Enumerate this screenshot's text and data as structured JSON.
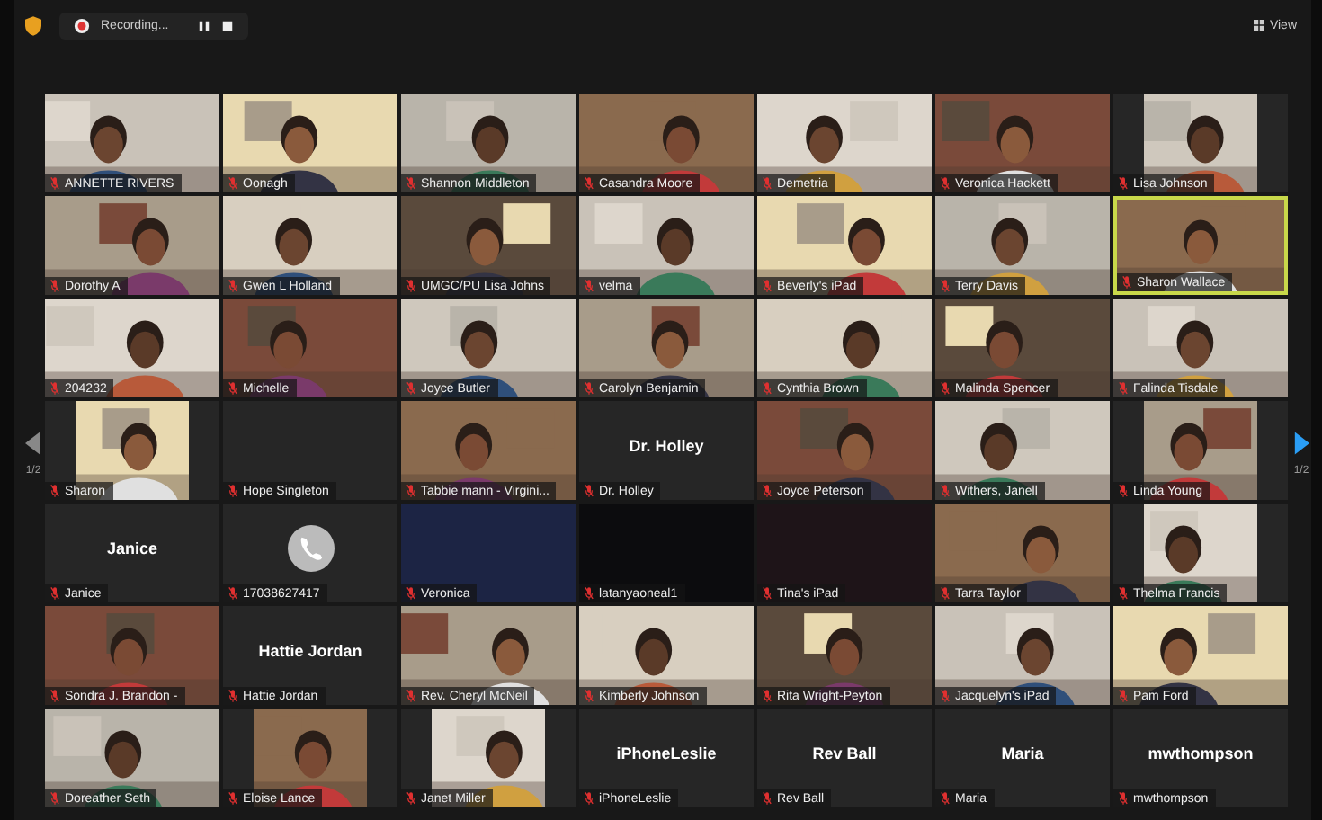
{
  "toolbar": {
    "recording": "Recording...",
    "view": "View"
  },
  "pager": {
    "left": "1/2",
    "right": "1/2"
  },
  "participants": [
    {
      "kind": "video",
      "name": "ANNETTE RIVERS",
      "muted": true,
      "active": false
    },
    {
      "kind": "video",
      "name": "Oonagh",
      "muted": true,
      "active": false
    },
    {
      "kind": "video",
      "name": "Shannon Middleton",
      "muted": true,
      "active": false
    },
    {
      "kind": "video",
      "name": "Casandra Moore",
      "muted": true,
      "active": false
    },
    {
      "kind": "video",
      "name": "Demetria",
      "muted": true,
      "active": false
    },
    {
      "kind": "video",
      "name": "Veronica Hackett",
      "muted": true,
      "active": false
    },
    {
      "kind": "portrait",
      "name": "Lisa Johnson",
      "muted": true,
      "active": false
    },
    {
      "kind": "video",
      "name": "Dorothy A",
      "muted": true,
      "active": false
    },
    {
      "kind": "video",
      "name": "Gwen L Holland",
      "muted": true,
      "active": false
    },
    {
      "kind": "video",
      "name": "UMGC/PU Lisa Johns",
      "muted": true,
      "active": false
    },
    {
      "kind": "video",
      "name": "velma",
      "muted": true,
      "active": false
    },
    {
      "kind": "video",
      "name": "Beverly's iPad",
      "muted": true,
      "active": false
    },
    {
      "kind": "video",
      "name": "Terry Davis",
      "muted": true,
      "active": false
    },
    {
      "kind": "video",
      "name": "Sharon Wallace",
      "muted": true,
      "active": true
    },
    {
      "kind": "video",
      "name": "204232",
      "muted": true,
      "active": false
    },
    {
      "kind": "video",
      "name": "Michelle",
      "muted": true,
      "active": false
    },
    {
      "kind": "video",
      "name": "Joyce Butler",
      "muted": true,
      "active": false
    },
    {
      "kind": "video",
      "name": "Carolyn Benjamin",
      "muted": true,
      "active": false
    },
    {
      "kind": "video",
      "name": "Cynthia Brown",
      "muted": true,
      "active": false
    },
    {
      "kind": "video",
      "name": "Malinda Spencer",
      "muted": true,
      "active": false
    },
    {
      "kind": "video",
      "name": "Falinda Tisdale",
      "muted": true,
      "active": false
    },
    {
      "kind": "portrait",
      "name": "Sharon",
      "muted": true,
      "active": false
    },
    {
      "kind": "blank",
      "name": "Hope Singleton",
      "muted": true,
      "active": false,
      "color": "#262626"
    },
    {
      "kind": "video",
      "name": "Tabbie mann - Virgini...",
      "muted": true,
      "active": false
    },
    {
      "kind": "name",
      "display_name": "Dr. Holley",
      "name": "Dr. Holley",
      "muted": true,
      "active": false
    },
    {
      "kind": "video",
      "name": "Joyce Peterson",
      "muted": true,
      "active": false
    },
    {
      "kind": "video",
      "name": "Withers, Janell",
      "muted": true,
      "active": false
    },
    {
      "kind": "portrait",
      "name": "Linda Young",
      "muted": true,
      "active": false
    },
    {
      "kind": "name",
      "display_name": "Janice",
      "name": "Janice",
      "muted": true,
      "active": false
    },
    {
      "kind": "phone",
      "name": "17038627417",
      "muted": true,
      "active": false
    },
    {
      "kind": "blank",
      "name": "Veronica",
      "muted": true,
      "active": false,
      "color": "#1c2444"
    },
    {
      "kind": "blank",
      "name": "latanyaoneal1",
      "muted": true,
      "active": false,
      "color": "#0c0c0e"
    },
    {
      "kind": "blank",
      "name": "Tina's iPad",
      "muted": true,
      "active": false,
      "color": "#1e1418"
    },
    {
      "kind": "video",
      "name": "Tarra Taylor",
      "muted": true,
      "active": false
    },
    {
      "kind": "portrait",
      "name": "Thelma Francis",
      "muted": true,
      "active": false
    },
    {
      "kind": "video",
      "name": "Sondra J. Brandon -",
      "muted": true,
      "active": false
    },
    {
      "kind": "name",
      "display_name": "Hattie Jordan",
      "name": "Hattie Jordan",
      "muted": true,
      "active": false
    },
    {
      "kind": "video",
      "name": "Rev. Cheryl McNeil",
      "muted": true,
      "active": false
    },
    {
      "kind": "video",
      "name": "Kimberly Johnson",
      "muted": true,
      "active": false
    },
    {
      "kind": "video",
      "name": "Rita Wright-Peyton",
      "muted": true,
      "active": false
    },
    {
      "kind": "video",
      "name": "Jacquelyn's iPad",
      "muted": true,
      "active": false
    },
    {
      "kind": "video",
      "name": "Pam Ford",
      "muted": true,
      "active": false
    },
    {
      "kind": "video",
      "name": "Doreather Seth",
      "muted": true,
      "active": false
    },
    {
      "kind": "portrait",
      "name": "Eloise Lance",
      "muted": true,
      "active": false
    },
    {
      "kind": "portrait",
      "name": "Janet Miller",
      "muted": true,
      "active": false
    },
    {
      "kind": "name",
      "display_name": "iPhoneLeslie",
      "name": "iPhoneLeslie",
      "muted": true,
      "active": false
    },
    {
      "kind": "name",
      "display_name": "Rev Ball",
      "name": "Rev Ball",
      "muted": true,
      "active": false
    },
    {
      "kind": "name",
      "display_name": "Maria",
      "name": "Maria",
      "muted": true,
      "active": false
    },
    {
      "kind": "name",
      "display_name": "mwthompson",
      "name": "mwthompson",
      "muted": true,
      "active": false
    }
  ]
}
